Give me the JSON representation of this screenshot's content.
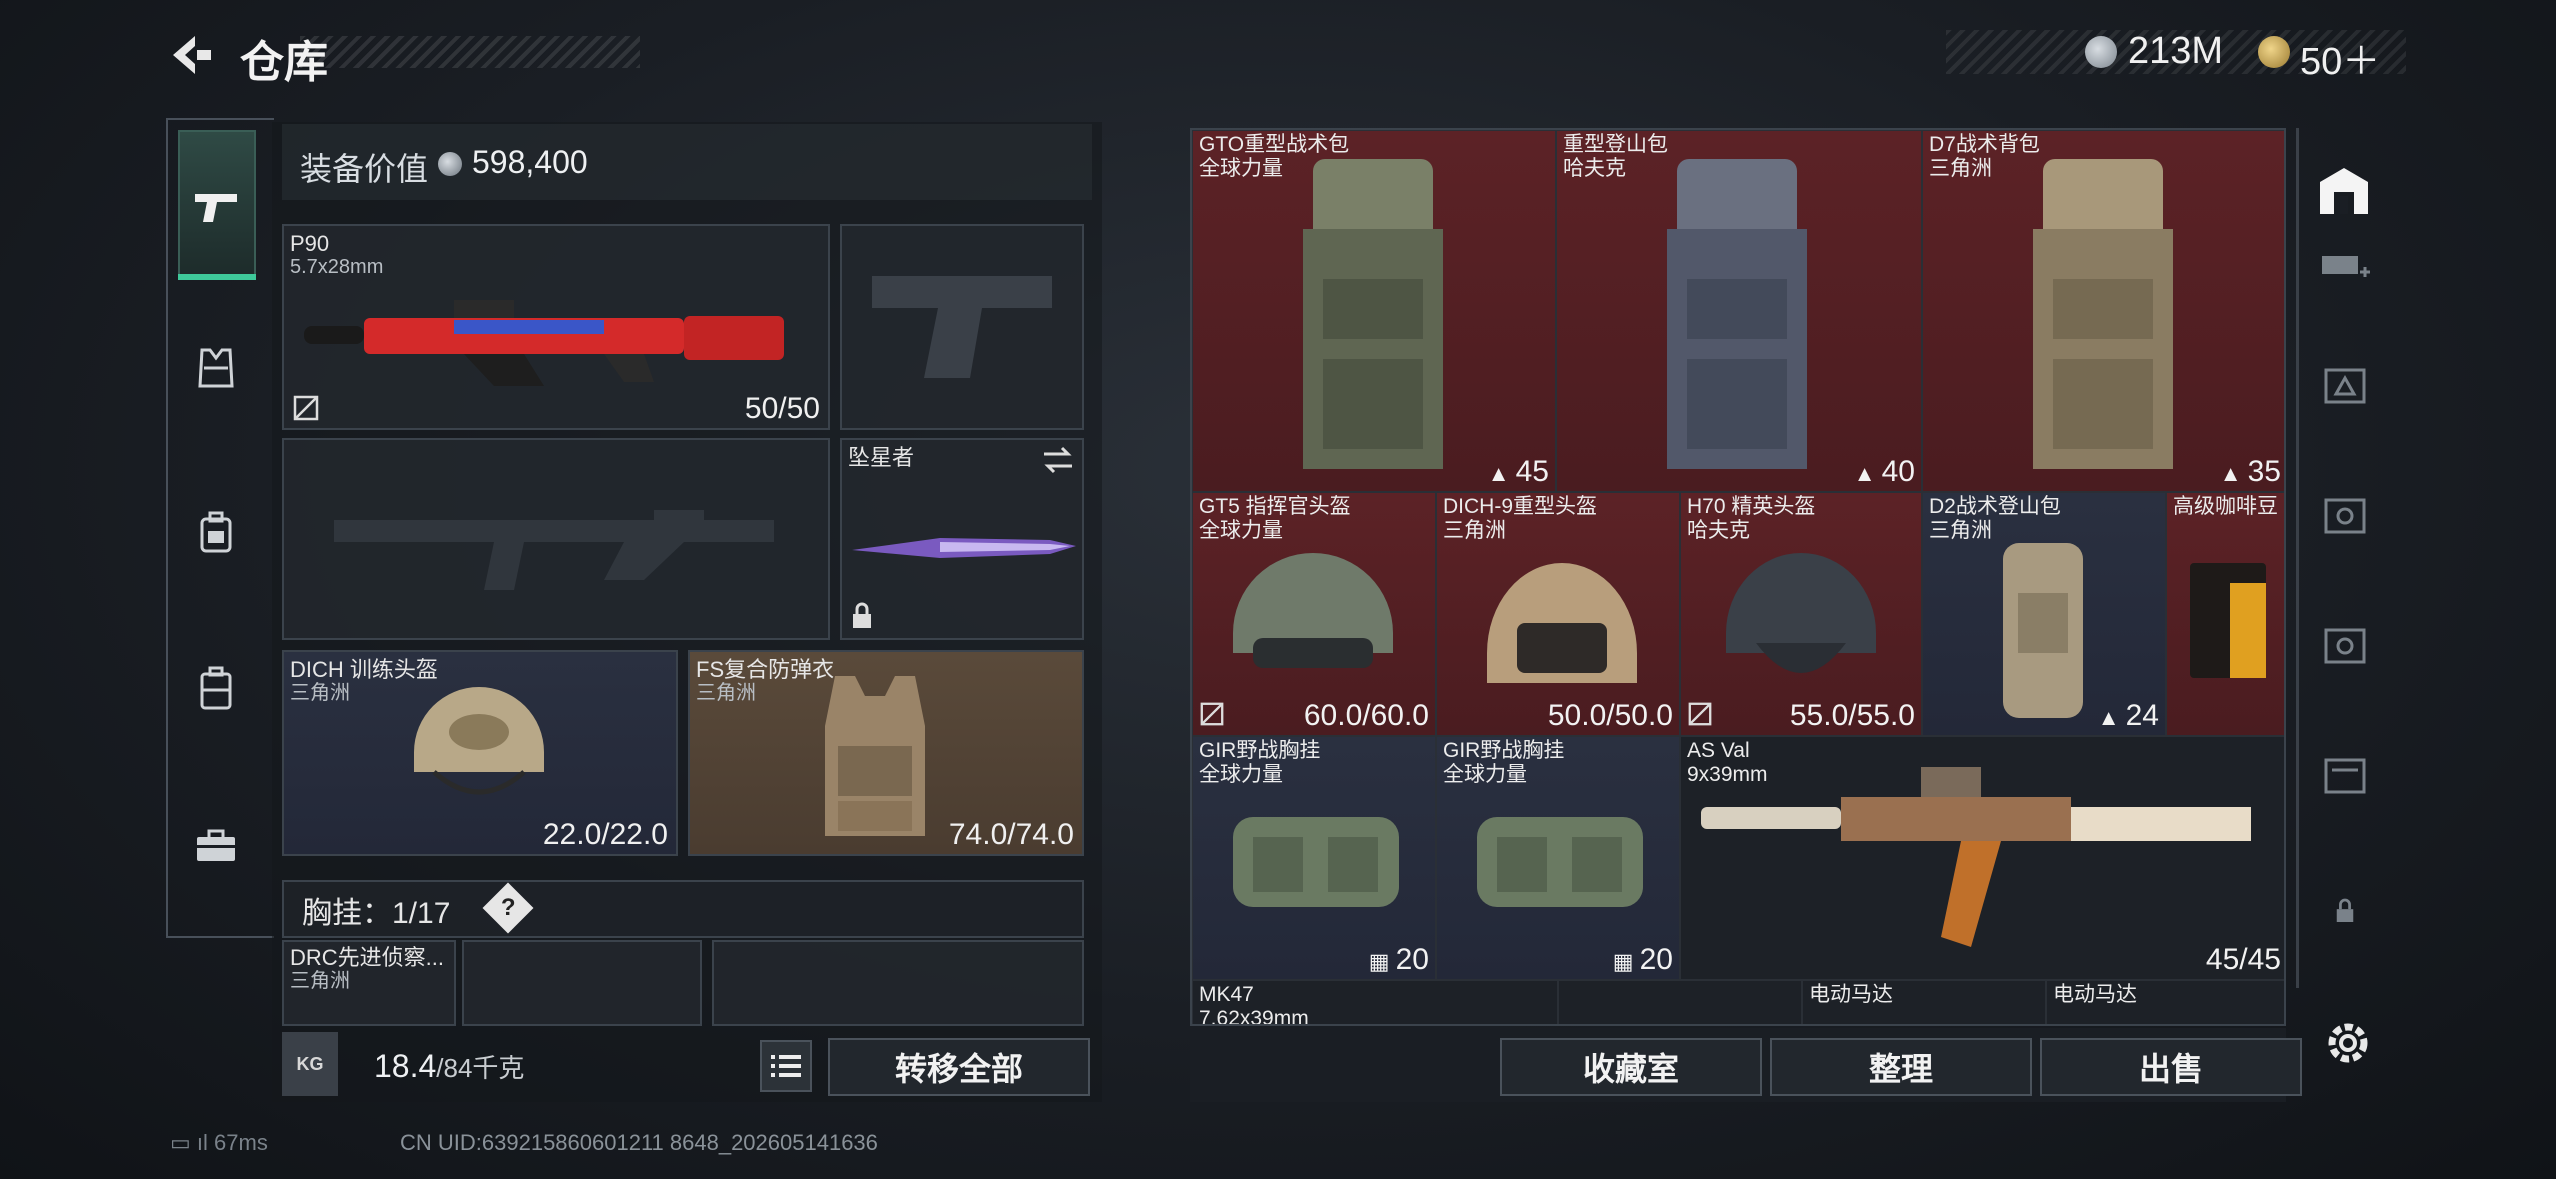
{
  "header": {
    "title": "仓库",
    "currency_primary": "213M",
    "currency_secondary": "50＋"
  },
  "left_rail": {
    "items": [
      "pistol-icon",
      "vest-icon",
      "backpack-icon",
      "luggage-icon",
      "briefcase-icon"
    ]
  },
  "equipment": {
    "value_label": "装备价值",
    "value": "598,400",
    "primary_weapon": {
      "name": "P90",
      "caliber": "5.7x28mm",
      "ammo": "50/50"
    },
    "melee": {
      "name": "坠星者"
    },
    "helmet": {
      "name": "DICH 训练头盔",
      "faction": "三角洲",
      "durability": "22.0/22.0"
    },
    "armor": {
      "name": "FS复合防弹衣",
      "faction": "三角洲",
      "durability": "74.0/74.0"
    },
    "chest_rig_label": "胸挂：1/17",
    "chest_rig_help": "?",
    "chest_item": {
      "name": "DRC先进侦察...",
      "faction": "三角洲"
    }
  },
  "bottom_left": {
    "weight_icon": "KG",
    "weight_current": "18.4",
    "weight_max": "/84千克",
    "transfer_all": "转移全部"
  },
  "inventory": [
    {
      "name": "GTO重型战术包",
      "sub": "全球力量",
      "count": "45"
    },
    {
      "name": "重型登山包",
      "sub": "哈夫克",
      "count": "40"
    },
    {
      "name": "D7战术背包",
      "sub": "三角洲",
      "count": "35"
    },
    {
      "name": "GT5 指挥官头盔",
      "sub": "全球力量",
      "count": "60.0/60.0"
    },
    {
      "name": "DICH-9重型头盔",
      "sub": "三角洲",
      "count": "50.0/50.0"
    },
    {
      "name": "H70 精英头盔",
      "sub": "哈夫克",
      "count": "55.0/55.0"
    },
    {
      "name": "D2战术登山包",
      "sub": "三角洲",
      "count": "24"
    },
    {
      "name": "高级咖啡豆",
      "sub": "",
      "count": ""
    },
    {
      "name": "GIR野战胸挂",
      "sub": "全球力量",
      "count": "20"
    },
    {
      "name": "GIR野战胸挂",
      "sub": "全球力量",
      "count": "20"
    },
    {
      "name": "AS Val",
      "sub": "9x39mm",
      "count": "45/45"
    },
    {
      "name": "MK47",
      "sub": "7.62x39mm",
      "count": ""
    },
    {
      "name": "电动马达",
      "sub": "",
      "count": ""
    },
    {
      "name": "电动马达",
      "sub": "",
      "count": ""
    }
  ],
  "actions": {
    "collection": "收藏室",
    "sort": "整理",
    "sell": "出售"
  },
  "status": {
    "ping": "67ms",
    "uid": "CN UID:639215860601211 8648_202605141636"
  },
  "colors": {
    "red_tier": "#5c2226",
    "blue_tier": "#2a3040",
    "accent": "#3ec99a"
  }
}
